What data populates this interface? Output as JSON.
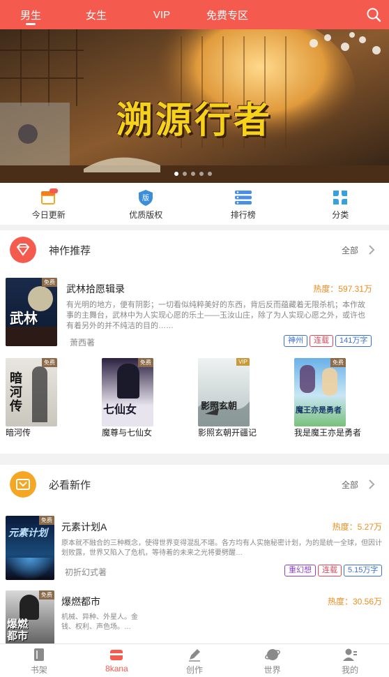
{
  "top_tabs": [
    {
      "label": "男生"
    },
    {
      "label": "女生"
    },
    {
      "label": "VIP"
    },
    {
      "label": "免费专区"
    }
  ],
  "banner": {
    "title": "溯源行者",
    "dot_count": 5,
    "active_dot": 0
  },
  "quick_nav": [
    {
      "label": "今日更新",
      "icon": "calendar-new-icon"
    },
    {
      "label": "优质版权",
      "icon": "copyright-shield-icon"
    },
    {
      "label": "排行榜",
      "icon": "ranking-list-icon"
    },
    {
      "label": "分类",
      "icon": "category-grid-icon"
    }
  ],
  "section1": {
    "title": "神作推荐",
    "more": "全部",
    "featured": {
      "title": "武林拾愿辑录",
      "free_badge": "免费",
      "heat": "热度：597.31万",
      "desc": "有光明的地方，便有阴影；一切看似纯粹美好的东西，背后反而蕴藏着无限杀机；本作故事的主舞台，武林中为人实现心愿的乐土——玉汝山庄，除了为人实现心愿之外，或许也有着另外的并不纯洁的目的……",
      "author": "萧西著",
      "tags": [
        "神州",
        "连载",
        "141万字"
      ],
      "cover_text": "武林"
    },
    "books": [
      {
        "title": "暗河传",
        "badge": "免费",
        "cover_text": "暗河传"
      },
      {
        "title": "魔尊与七仙女",
        "badge": "免费",
        "cover_text": "七仙女"
      },
      {
        "title": "影照玄朝开疆记",
        "badge": "VIP",
        "cover_text": "影照玄朝"
      },
      {
        "title": "我是魔王亦是勇者",
        "badge": "免费",
        "cover_text": "魔王亦是勇者"
      }
    ]
  },
  "section2": {
    "title": "必看新作",
    "more": "全部",
    "items": [
      {
        "title": "元素计划A",
        "badge": "免费",
        "heat": "热度：5.27万",
        "desc": "原本就不融合的三种概念，使得世界变得混乱不堪。各方均有人实施秘密计划，为的是统一全球，但因计划败露，世界又陷入了危机，等待着的未来之光将要劈醒…",
        "author": "初折幻式著",
        "tags": [
          "重幻想",
          "连载",
          "5.15万字"
        ],
        "cover_text": "元素计划"
      },
      {
        "title": "爆燃都市",
        "badge": "免费",
        "heat": "热度：30.56万",
        "desc": "机械、异种、外星人。金钱、权利、声色场。…",
        "author": "",
        "tags": [],
        "cover_text": "爆燃都市"
      }
    ]
  },
  "bottom_nav": [
    {
      "label": "书架",
      "icon": "bookshelf-icon"
    },
    {
      "label": "8kana",
      "icon": "8kana-home-icon"
    },
    {
      "label": "创作",
      "icon": "pen-create-icon"
    },
    {
      "label": "世界",
      "icon": "world-planet-icon"
    },
    {
      "label": "我的",
      "icon": "profile-icon"
    }
  ],
  "colors": {
    "brand": "#f55a4e",
    "heat": "#f08c1e",
    "tag_blue": "#3a6fd8",
    "tag_red": "#e0485a",
    "tag_purple": "#8b3fd0"
  }
}
